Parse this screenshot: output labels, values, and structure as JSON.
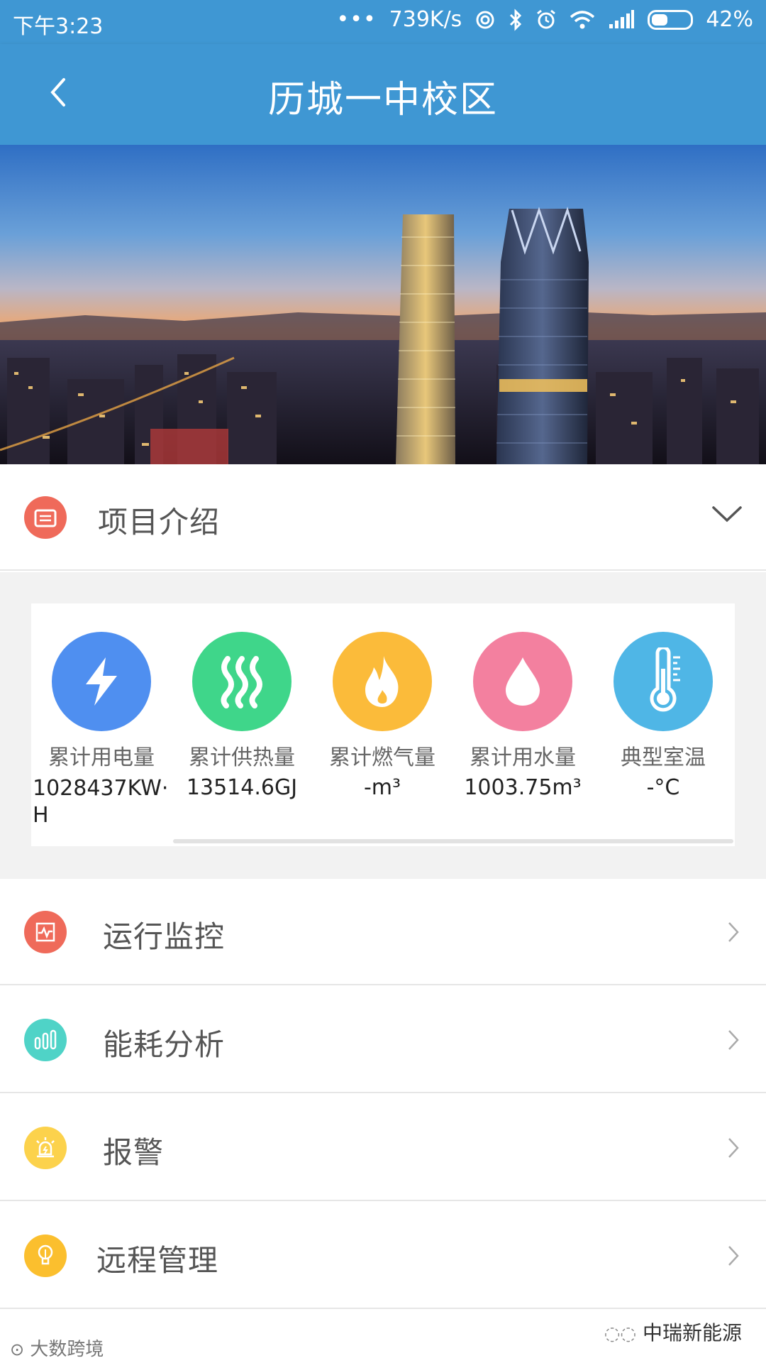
{
  "status_bar": {
    "time": "下午3:23",
    "network_speed": "739K/s",
    "battery": "42%",
    "battery_level": 0.42
  },
  "header": {
    "title": "历城一中校区",
    "back_icon": "chevron-left-icon"
  },
  "intro": {
    "label": "项目介绍",
    "icon": "folder-list-icon",
    "icon_color": "#ef6a5a"
  },
  "stats": [
    {
      "name": "累计用电量",
      "value": "1028437KW·H",
      "icon": "lightning-icon",
      "color": "#4f8ff0"
    },
    {
      "name": "累计供热量",
      "value": "13514.6GJ",
      "icon": "heat-waves-icon",
      "color": "#3fd68a"
    },
    {
      "name": "累计燃气量",
      "value": "-m³",
      "icon": "flame-icon",
      "color": "#fbbb3a"
    },
    {
      "name": "累计用水量",
      "value": "1003.75m³",
      "icon": "water-drop-icon",
      "color": "#f3809f"
    },
    {
      "name": "典型室温",
      "value": "-°C",
      "icon": "thermometer-icon",
      "color": "#4fb6e6"
    }
  ],
  "menu": [
    {
      "label": "运行监控",
      "icon": "monitor-pulse-icon",
      "color": "#ef6a5a"
    },
    {
      "label": "能耗分析",
      "icon": "bar-chart-icon",
      "color": "#4fd3c7"
    },
    {
      "label": "报警",
      "icon": "alarm-light-icon",
      "color": "#fcd24c"
    },
    {
      "label": "远程管理",
      "icon": "bulb-icon",
      "color": "#fbbf2e"
    }
  ],
  "watermarks": {
    "left": "大数跨境",
    "right": "中瑞新能源"
  }
}
